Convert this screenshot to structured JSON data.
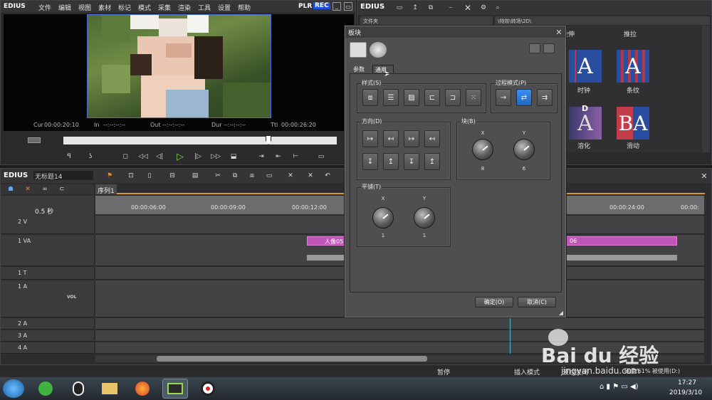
{
  "preview": {
    "app": "EDIUS",
    "menu": [
      "文件",
      "编辑",
      "视图",
      "素材",
      "标记",
      "模式",
      "采集",
      "渲染",
      "工具",
      "设置",
      "帮助"
    ],
    "plr": "PLR",
    "rec": "REC",
    "tc": {
      "cur_label": "Cur",
      "cur": "00:00:20:10",
      "in_label": "In",
      "in": "--:--:--:--",
      "out_label": "Out",
      "out": "--:--:--:--",
      "dur_label": "Dur",
      "dur": "--:--:--:--",
      "ttl_label": "Ttl",
      "ttl": "00:00:26:20"
    }
  },
  "bin": {
    "app": "EDIUS",
    "col_header": "文件夹",
    "path": "\\特效\\转场\\2D\\",
    "items": [
      {
        "label": "拉伸"
      },
      {
        "label": "推拉"
      },
      {
        "label": "时钟"
      },
      {
        "label": "条纹"
      },
      {
        "label": "溶化"
      },
      {
        "label": "滑动"
      }
    ]
  },
  "timeline": {
    "app": "EDIUS",
    "project": "无标题14",
    "sequence_tab": "序列1",
    "zoom": "0.5 秒",
    "ruler": [
      "00:00:06:00",
      "00:00:09:00",
      "00:00:12:00",
      "00:00:24:00",
      "00:00:"
    ],
    "tracks": [
      {
        "name": "2 V"
      },
      {
        "name": "1 VA"
      },
      {
        "name": "1 T"
      },
      {
        "name": "1 A",
        "vol": "VOL"
      },
      {
        "name": "2 A"
      },
      {
        "name": "3 A"
      },
      {
        "name": "4 A"
      }
    ],
    "clip1": "人像05",
    "clip2": "06"
  },
  "status": {
    "pause": "暂停",
    "insert_mode": "插入模式",
    "ripple": "波纹关闭",
    "disk": "磁盘:61% 被使用(D:)"
  },
  "taskbar": {
    "time": "17:27",
    "date": "2019/3/10"
  },
  "dialog": {
    "title": "板块",
    "tab_params": "参数",
    "tab_general": "通用",
    "style_label": "样式(S)",
    "process_label": "过程模式(P)",
    "direction_label": "方向(D)",
    "block_label": "块(B)",
    "tile_label": "平铺(T)",
    "block_x_axis": "X",
    "block_y_axis": "Y",
    "block_x": "8",
    "block_y": "6",
    "tile_x_axis": "X",
    "tile_y_axis": "Y",
    "tile_x": "1",
    "tile_y": "1",
    "ok": "确定(O)",
    "cancel": "取消(C)"
  },
  "watermark": {
    "brand": "Bai du 经验",
    "url": "jingyan.baidu.com"
  },
  "colors": {
    "accent_blue": "#2a72d6",
    "rec_blue": "#1f4fd6",
    "clip_pink": "#c056b8",
    "timeline_orange": "#d99a2b"
  }
}
